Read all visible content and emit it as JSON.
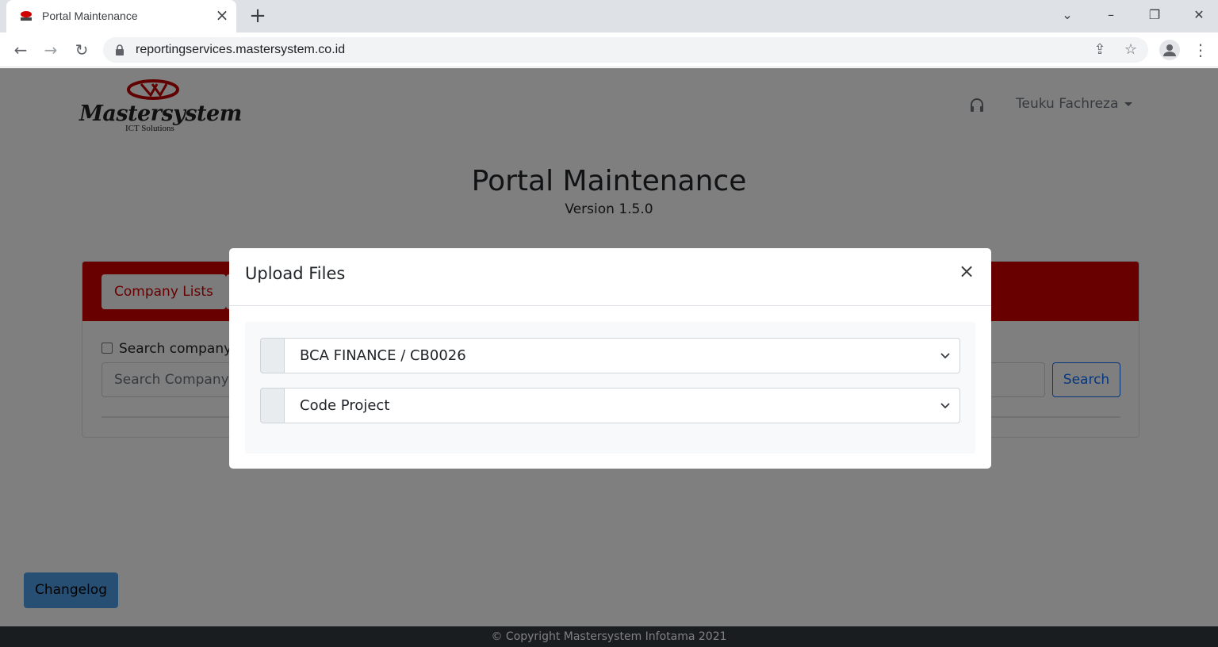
{
  "browser": {
    "tab_title": "Portal Maintenance",
    "url": "reportingservices.mastersystem.co.id"
  },
  "header": {
    "logo_text": "Mastersystem",
    "logo_subtext": "ICT Solutions",
    "user_name": "Teuku Fachreza"
  },
  "page": {
    "title": "Portal Maintenance",
    "version": "Version 1.5.0"
  },
  "card": {
    "tabs": [
      {
        "label": "Company Lists"
      }
    ],
    "search_checkbox_label": "Search company",
    "search_placeholder": "Search Company",
    "search_button": "Search"
  },
  "changelog_button": "Changelog",
  "footer": {
    "copyright": "© Copyright Mastersystem Infotama 2021"
  },
  "modal": {
    "title": "Upload Files",
    "close_symbol": "×",
    "company_select": "BCA FINANCE / CB0026",
    "project_select": "Code Project"
  },
  "colors": {
    "brand_red": "#d00000",
    "primary_blue": "#0d6efd",
    "changelog_blue": "#4f9fe6"
  }
}
